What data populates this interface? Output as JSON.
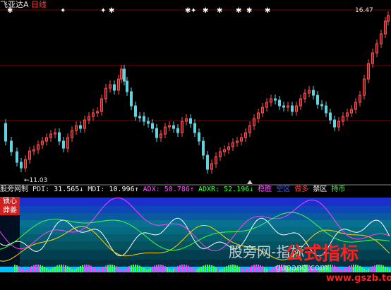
{
  "header": {
    "stock_name": "飞亚达A",
    "period": "日线"
  },
  "price_panel": {
    "high_label": "16.47",
    "low_label": "11.03",
    "flag_marks": [
      "✱",
      "✦",
      "✦",
      "✱",
      "✱",
      "✦",
      "✱",
      "✱",
      "✱",
      "✱",
      "✱"
    ]
  },
  "indicator_bar": {
    "name": "股旁网制",
    "pdi_label": "PDI:",
    "pdi_value": "31.565↓",
    "mdi_label": "MDI:",
    "mdi_value": "10.996↑",
    "adx_label": "ADX:",
    "adx_value": "50.786↑",
    "adxr_label": "ADXR:",
    "adxr_value": "52.196↓",
    "s1": "稳胜",
    "s2": "空区",
    "s3": "做多",
    "s4": "禁区",
    "s5": "持币"
  },
  "side_labels": {
    "top": "锁心",
    "bottom": "莽姜"
  },
  "watermark": {
    "site_cn": "股旁网-",
    "site_cn2": "指标",
    "site_cn3": "公式",
    "brand": "公式指标",
    "url": "www.gszb.top",
    "url2": "gupang.com"
  },
  "colors": {
    "up": "#ff4d4d",
    "down": "#5fd3e0",
    "grid": "#7a0000",
    "pdi": "#ffffff",
    "mdi": "#ffd400",
    "adx": "#ff40ff",
    "adxr": "#40ff40"
  }
}
